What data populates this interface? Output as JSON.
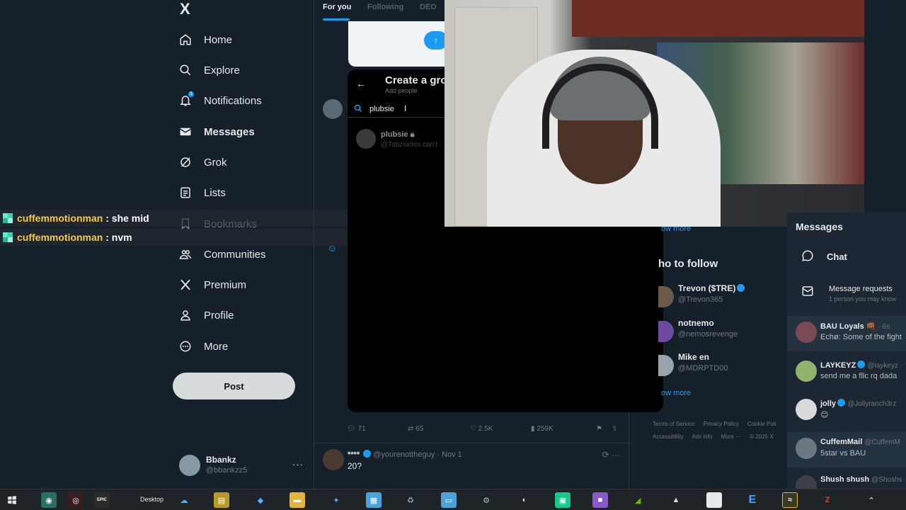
{
  "sidebar": {
    "logo": "X",
    "items": [
      {
        "label": "Home",
        "icon": "home-icon"
      },
      {
        "label": "Explore",
        "icon": "search-icon"
      },
      {
        "label": "Notifications",
        "icon": "bell-icon",
        "badge": "1"
      },
      {
        "label": "Messages",
        "icon": "mail-icon"
      },
      {
        "label": "Grok",
        "icon": "grok-icon"
      },
      {
        "label": "Lists",
        "icon": "list-icon"
      },
      {
        "label": "Bookmarks",
        "icon": "bookmark-icon"
      },
      {
        "label": "Communities",
        "icon": "people-icon"
      },
      {
        "label": "Premium",
        "icon": "x-icon"
      },
      {
        "label": "Profile",
        "icon": "person-icon"
      },
      {
        "label": "More",
        "icon": "more-circle-icon"
      }
    ],
    "post_label": "Post",
    "account": {
      "name": "Bbankz",
      "handle": "@bbankzz5",
      "menu": "···"
    }
  },
  "feed": {
    "tabs": [
      "For you",
      "Following",
      "DEO"
    ],
    "actions": {
      "replies": "71",
      "reposts": "65",
      "likes": "2.5K",
      "views": "259K"
    },
    "tweet2": {
      "name": "****",
      "handle": "@yourenottheguy",
      "date": "· Nov 1",
      "text": "20?"
    }
  },
  "modal": {
    "title": "Create a gro",
    "subtitle": "Add people",
    "search_value": "plubsie",
    "result": {
      "name": "plubsie",
      "handle": "@Tabzsicles can't"
    }
  },
  "chat": [
    {
      "user": "cuffemmotionman",
      "message": " : she mid"
    },
    {
      "user": "cuffemmotionman",
      "message": " : nvm"
    }
  ],
  "right": {
    "show_more": "ow more",
    "who_to_follow": "ho to follow",
    "suggestions": [
      {
        "name": "Trevon ($TRE)",
        "handle": "@Trevon365",
        "verified": true
      },
      {
        "name": "notnemo",
        "handle": "@nemosrevenge",
        "verified": false
      },
      {
        "name": "Mike en",
        "handle": "@MDRPTD00",
        "verified": false
      }
    ],
    "footer": [
      "Terms of Service",
      "Privacy Policy",
      "Cookie Poli",
      "Accessibility",
      "Ads info",
      "More ···",
      "© 2025 X"
    ]
  },
  "messages": {
    "title": "Messages",
    "chat_label": "Chat",
    "requests_title": "Message requests",
    "requests_sub": "1 person you may know",
    "conversations": [
      {
        "name": "BAU Loyals 👊🏾",
        "meta": "· 6s",
        "message": "Echø: Some of the fight",
        "color": "#7a4a56"
      },
      {
        "name": "LAYKEYZ",
        "meta": "@laykeyz ·",
        "message": "send me a fllc rq dada",
        "color": "#8fb36b"
      },
      {
        "name": "jolly",
        "meta": "@Jollyranch3rz",
        "message": "😊",
        "color": "#d9d9d9"
      },
      {
        "name": "CuffemMail",
        "meta": "@CuffemM",
        "message": "5star vs BAU",
        "color": "#6c7780"
      },
      {
        "name": "Shush shush",
        "meta": "@Shushs",
        "message": "",
        "color": "#3d4147"
      }
    ]
  },
  "taskbar": {
    "desktop_label": "Desktop",
    "epic_label": "EPIC"
  },
  "colors": {
    "accent": "#1d9bf0",
    "background": "#16202b",
    "chat_user": "#f5c94b"
  }
}
